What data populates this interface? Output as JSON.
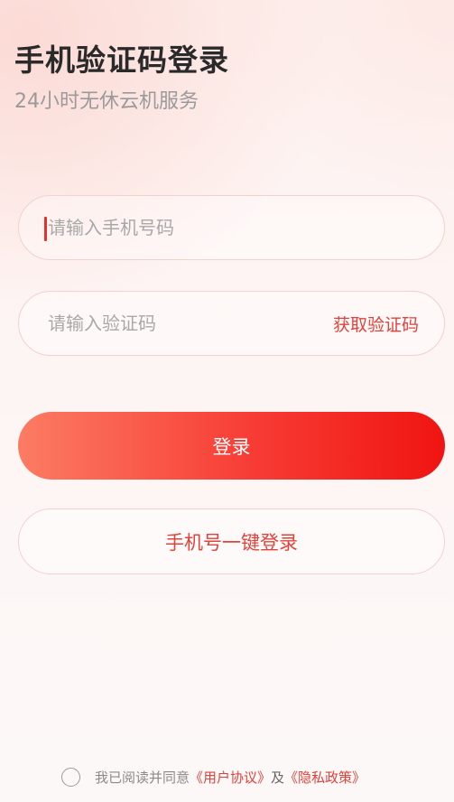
{
  "header": {
    "title": "手机验证码登录",
    "subtitle": "24小时无休云机服务"
  },
  "form": {
    "phone_placeholder": "请输入手机号码",
    "phone_value": "",
    "code_placeholder": "请输入验证码",
    "code_value": "",
    "get_code_label": "获取验证码"
  },
  "buttons": {
    "login_label": "登录",
    "one_key_login_label": "手机号一键登录"
  },
  "agreement": {
    "checked": false,
    "prefix": "我已阅读并同意",
    "user_agreement": "《用户协议》",
    "conjunction": "及",
    "privacy_policy": "《隐私政策》"
  },
  "colors": {
    "accent": "#e0433b",
    "button_gradient_start": "#fc7c63",
    "button_gradient_end": "#f01411"
  }
}
